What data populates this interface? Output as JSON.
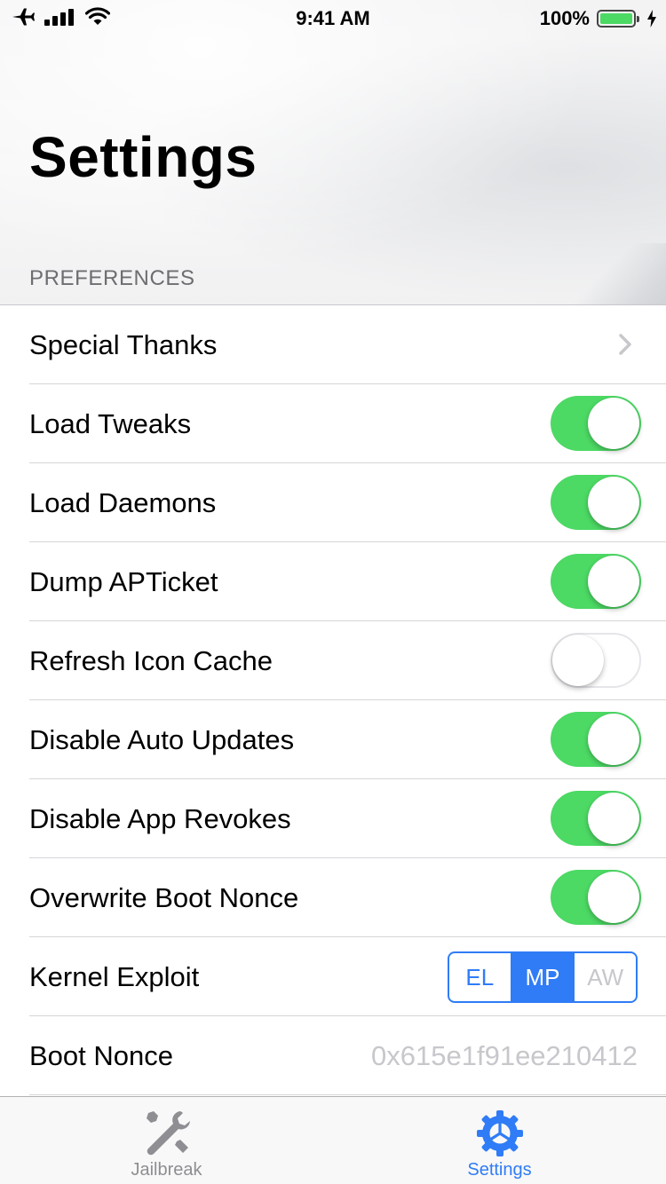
{
  "status_bar": {
    "time": "9:41 AM",
    "battery_percent": "100%"
  },
  "header": {
    "title": "Settings"
  },
  "section": {
    "header": "PREFERENCES"
  },
  "rows": {
    "special_thanks": {
      "label": "Special Thanks"
    },
    "load_tweaks": {
      "label": "Load Tweaks",
      "on": true
    },
    "load_daemons": {
      "label": "Load Daemons",
      "on": true
    },
    "dump_apticket": {
      "label": "Dump APTicket",
      "on": true
    },
    "refresh_icon_cache": {
      "label": "Refresh Icon Cache",
      "on": false
    },
    "disable_auto_updates": {
      "label": "Disable Auto Updates",
      "on": true
    },
    "disable_app_revokes": {
      "label": "Disable App Revokes",
      "on": true
    },
    "overwrite_boot_nonce": {
      "label": "Overwrite Boot Nonce",
      "on": true
    },
    "kernel_exploit": {
      "label": "Kernel Exploit",
      "segments": [
        "EL",
        "MP",
        "AW"
      ],
      "selected": "MP",
      "disabled": [
        "AW"
      ]
    },
    "boot_nonce": {
      "label": "Boot Nonce",
      "value": "0x615e1f91ee210412"
    }
  },
  "tab_bar": {
    "tabs": [
      {
        "label": "Jailbreak",
        "icon": "wrench-screwdriver-icon",
        "active": false
      },
      {
        "label": "Settings",
        "icon": "gear-icon",
        "active": true
      }
    ]
  },
  "colors": {
    "accent": "#2f7cf6",
    "toggle_on": "#4cd964",
    "secondary_text": "#6d6d72",
    "placeholder": "#c7c7cc"
  }
}
